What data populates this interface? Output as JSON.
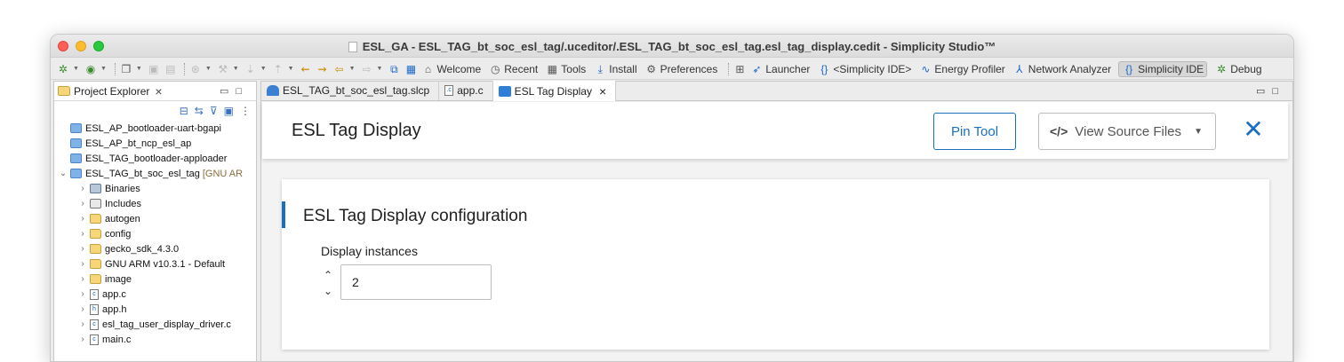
{
  "window": {
    "title": "ESL_GA - ESL_TAG_bt_soc_esl_tag/.uceditor/.ESL_TAG_bt_soc_esl_tag.esl_tag_display.cedit - Simplicity Studio™"
  },
  "toolbar": {
    "perspectives": [
      {
        "label": "Welcome",
        "icon": "home-icon"
      },
      {
        "label": "Recent",
        "icon": "history-icon"
      },
      {
        "label": "Tools",
        "icon": "grid-icon"
      },
      {
        "label": "Install",
        "icon": "download-icon"
      },
      {
        "label": "Preferences",
        "icon": "gear-icon"
      }
    ],
    "launcher": {
      "label": "Launcher",
      "icon": "rocket-icon"
    },
    "simplicity_ide_link": {
      "label": "<Simplicity IDE>",
      "icon": "braces-icon"
    },
    "energy_profiler": {
      "label": "Energy Profiler",
      "icon": "pulse-icon"
    },
    "network_analyzer": {
      "label": "Network Analyzer",
      "icon": "network-icon"
    },
    "simplicity_ide": {
      "label": "Simplicity IDE",
      "icon": "braces-icon"
    },
    "debug": {
      "label": "Debug",
      "icon": "bug-icon"
    }
  },
  "project_explorer": {
    "tab_label": "Project Explorer",
    "items": [
      {
        "label": "ESL_AP_bootloader-uart-bgapi",
        "type": "project",
        "indent": 0
      },
      {
        "label": "ESL_AP_bt_ncp_esl_ap",
        "type": "project",
        "indent": 0
      },
      {
        "label": "ESL_TAG_bootloader-apploader",
        "type": "project",
        "indent": 0
      },
      {
        "label": "ESL_TAG_bt_soc_esl_tag",
        "suffix": "[GNU AR",
        "type": "project-open",
        "indent": 0
      },
      {
        "label": "Binaries",
        "type": "binaries",
        "indent": 1
      },
      {
        "label": "Includes",
        "type": "includes",
        "indent": 1
      },
      {
        "label": "autogen",
        "type": "folder",
        "indent": 1
      },
      {
        "label": "config",
        "type": "folder",
        "indent": 1
      },
      {
        "label": "gecko_sdk_4.3.0",
        "type": "folder",
        "indent": 1
      },
      {
        "label": "GNU ARM v10.3.1 - Default",
        "type": "folder",
        "indent": 1
      },
      {
        "label": "image",
        "type": "folder",
        "indent": 1
      },
      {
        "label": "app.c",
        "type": "c-file",
        "indent": 1
      },
      {
        "label": "app.h",
        "type": "h-file",
        "indent": 1
      },
      {
        "label": "esl_tag_user_display_driver.c",
        "type": "c-file",
        "indent": 1
      },
      {
        "label": "main.c",
        "type": "c-file",
        "indent": 1
      }
    ]
  },
  "editor": {
    "tabs": [
      {
        "label": "ESL_TAG_bt_soc_esl_tag.slcp"
      },
      {
        "label": "app.c"
      },
      {
        "label": "ESL Tag Display"
      }
    ],
    "header": {
      "title": "ESL Tag Display",
      "pin_tool": "Pin Tool",
      "view_source": "View Source Files"
    },
    "card": {
      "title": "ESL Tag Display configuration",
      "field_label": "Display instances",
      "field_value": "2"
    }
  },
  "colors": {
    "accent": "#1a6fbf",
    "close_red": "#fe5f57",
    "minimize_yellow": "#febc2e",
    "maximize_green": "#28c840"
  }
}
